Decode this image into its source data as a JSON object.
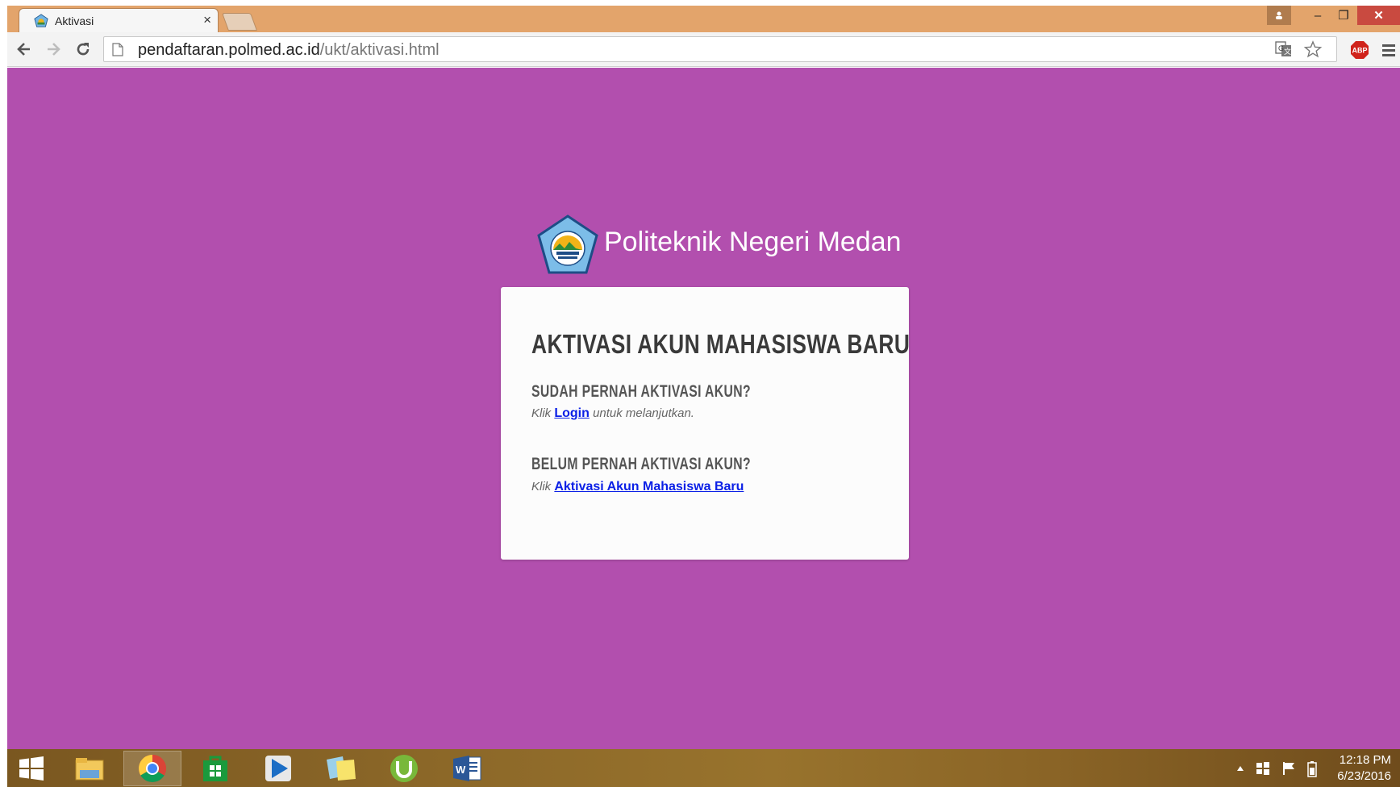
{
  "browser": {
    "tab": {
      "title": "Aktivasi",
      "close_glyph": "×"
    },
    "url": {
      "host": "pendaftaran.polmed.ac.id",
      "path": "/ukt/aktivasi.html"
    },
    "window_controls": {
      "minimize": "–",
      "restore": "❐",
      "close": "✕"
    },
    "extensions": {
      "abp_label": "ABP"
    },
    "icons": [
      "back-icon",
      "forward-icon",
      "reload-icon",
      "page-icon",
      "translate-icon",
      "star-icon",
      "menu-icon"
    ]
  },
  "page": {
    "background_color": "#b24fae",
    "brand_name": "Politeknik Negeri Medan",
    "card": {
      "title": "AKTIVASI AKUN MAHASISWA BARU",
      "section1": {
        "heading": "SUDAH PERNAH AKTIVASI AKUN?",
        "prefix": "Klik",
        "link": "Login",
        "suffix": "untuk melanjutkan."
      },
      "section2": {
        "heading": "BELUM PERNAH AKTIVASI AKUN?",
        "prefix": "Klik",
        "link": "Aktivasi Akun Mahasiswa Baru"
      }
    }
  },
  "taskbar": {
    "apps": [
      "start",
      "file-explorer",
      "chrome",
      "store",
      "media-player",
      "sticky-notes",
      "utorrent",
      "word"
    ],
    "clock": {
      "time": "12:18 PM",
      "date": "6/23/2016"
    }
  }
}
